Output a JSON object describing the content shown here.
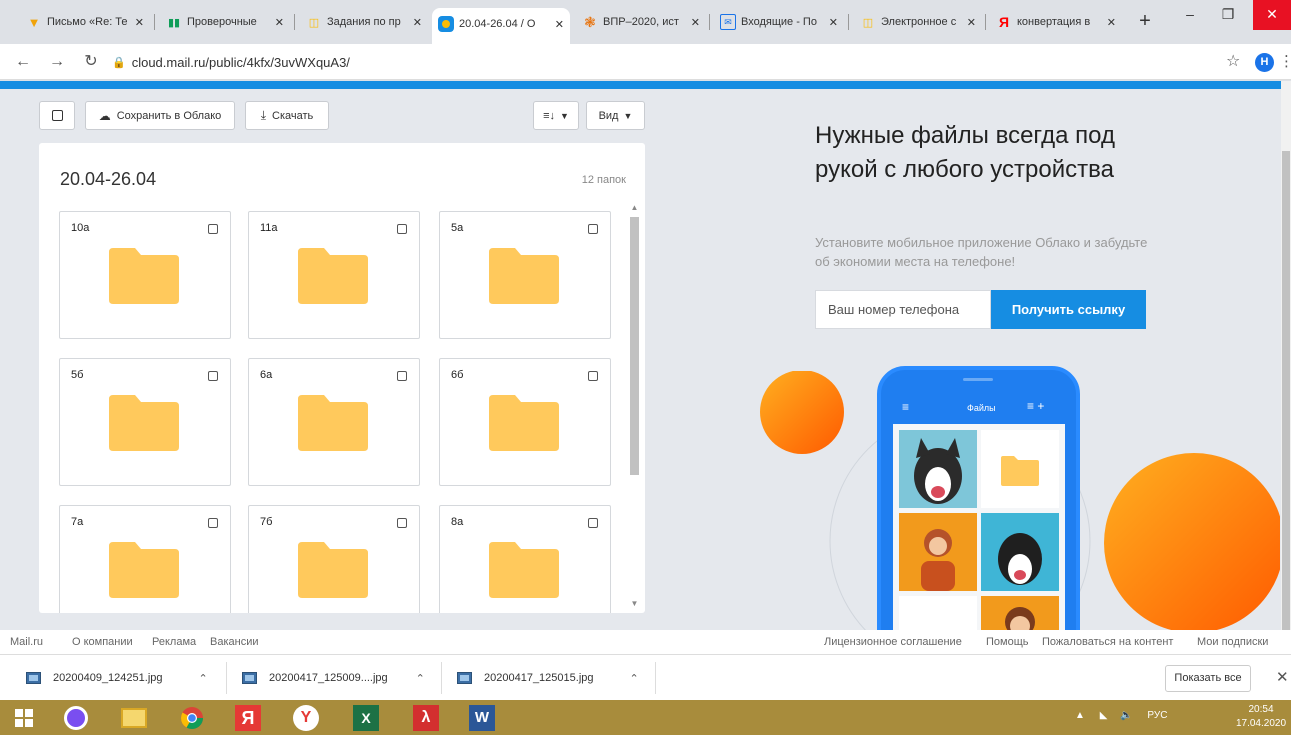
{
  "browser": {
    "tabs": [
      {
        "label": "Письмо «Re: Те",
        "icon": "mail-icon",
        "color": "#f0a30a"
      },
      {
        "label": "Проверочные",
        "icon": "sheets-icon",
        "color": "#0f9d58"
      },
      {
        "label": "Задания по пр",
        "icon": "book-icon",
        "color": "#fbbc04"
      },
      {
        "label": "20.04-26.04 / О",
        "icon": "cloud-icon",
        "color": "#168de2",
        "active": true
      },
      {
        "label": "ВПР–2020, ист",
        "icon": "gear-icon",
        "color": "#e8710a"
      },
      {
        "label": "Входящие - По",
        "icon": "inbox-icon",
        "color": "#1a73e8"
      },
      {
        "label": "Электронное с",
        "icon": "book-icon",
        "color": "#fbbc04"
      },
      {
        "label": "конвертация в",
        "icon": "yandex-icon",
        "color": "#ff0000"
      }
    ],
    "url": "cloud.mail.ru/public/4kfx/3uvWXquA3/",
    "profile_initial": "Н"
  },
  "toolbar": {
    "save_label": "Сохранить в Облако",
    "download_label": "Скачать",
    "view_label": "Вид"
  },
  "panel": {
    "title": "20.04-26.04",
    "count": "12 папок",
    "folders": [
      "10а",
      "11а",
      "5а",
      "5б",
      "6а",
      "6б",
      "7а",
      "7б",
      "8а"
    ]
  },
  "promo": {
    "title": "Нужные файлы всегда под рукой с любого устройства",
    "subtitle": "Установите мобильное приложение Облако и забудьте об экономии места на телефоне!",
    "phone_placeholder": "Ваш номер телефона",
    "button_label": "Получить ссылку",
    "phone_screen_title": "Файлы"
  },
  "footer": {
    "left_links": [
      "Mail.ru",
      "О компании",
      "Реклама",
      "Вакансии"
    ],
    "right_links": [
      "Лицензионное соглашение",
      "Помощь",
      "Пожаловаться на контент",
      "Мои подписки"
    ]
  },
  "downloads": {
    "items": [
      "20200409_124251.jpg",
      "20200417_125009....jpg",
      "20200417_125015.jpg"
    ],
    "show_all": "Показать все"
  },
  "taskbar": {
    "lang": "РУС",
    "time": "20:54",
    "date": "17.04.2020"
  }
}
